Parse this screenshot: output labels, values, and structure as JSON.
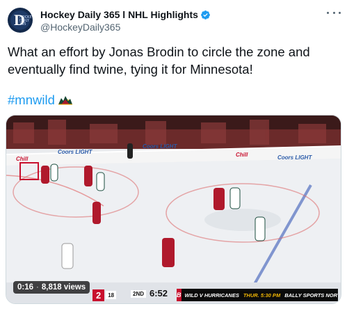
{
  "tweet": {
    "display_name": "Hockey Daily 365 l NHL Highlights",
    "handle": "@HockeyDaily365",
    "text": "What an effort by Jonas Brodin to circle the zone and eventually find twine, tying it for Minnesota!",
    "hashtag": "#mnwild",
    "avatar_letter": "D",
    "avatar_small_text": "HOCKEY DAILY 365"
  },
  "video": {
    "elapsed": "0:16",
    "views": "8,818 views",
    "scorebug": {
      "home_score": "2",
      "home_shots": "18",
      "period": "2ND",
      "clock": "6:52",
      "ticker_logo": "B",
      "ticker_text": "WILD V HURRICANES",
      "ticker_time": "THUR. 5:30 PM",
      "ticker_network": "BALLY SPORTS NORTH"
    },
    "board_ads": [
      "Chill",
      "Coors LIGHT",
      "Coors LIGHT",
      "Chill",
      "Coors LIGHT"
    ]
  },
  "colors": {
    "verified_blue": "#1d9bf0",
    "hashtag_blue": "#1d9bf0",
    "hurricanes_red": "#c8102e",
    "wild_green": "#154734"
  },
  "icons": {
    "verified": "verified-badge-icon",
    "more": "more-options-icon",
    "emoji": "minnesota-wild-emoji-icon"
  }
}
